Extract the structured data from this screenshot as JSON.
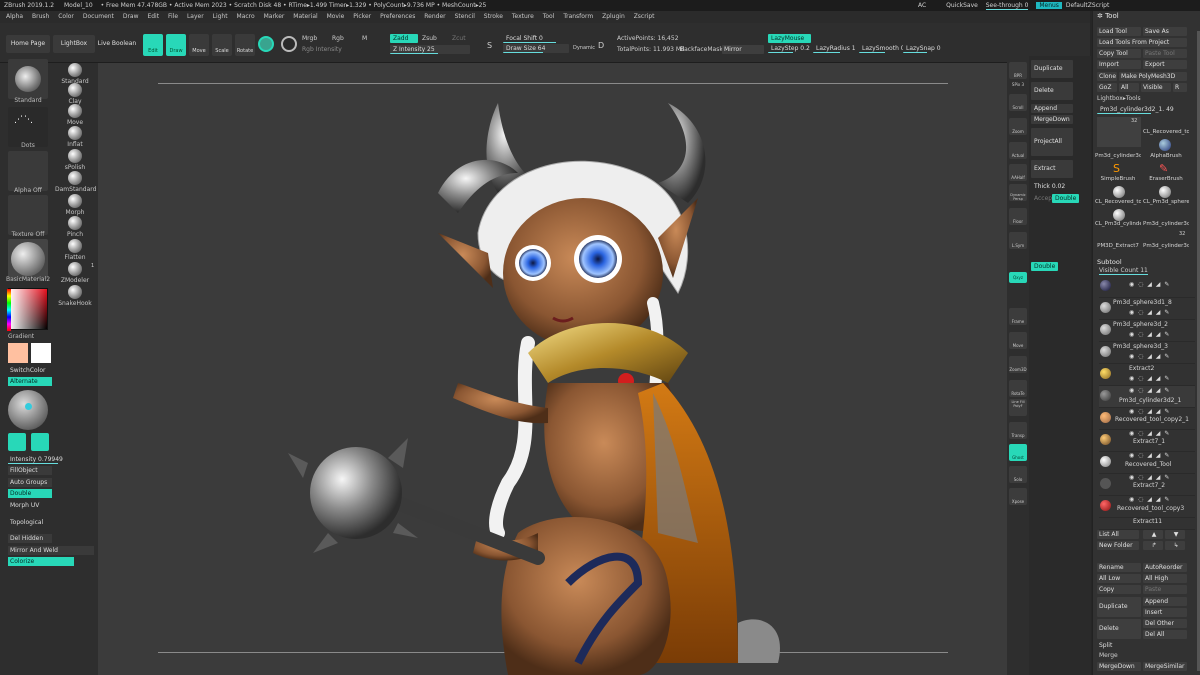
{
  "title_bar": {
    "app": "ZBrush 2019.1.2",
    "model": "Model_10",
    "stats": "• Free Mem 47.478GB • Active Mem 2023 • Scratch Disk 48 • RTime▸1.499 Timer▸1.329 • PolyCount▸9.736 MP • MeshCount▸25"
  },
  "right_menu": {
    "ac": "AC",
    "quicksave": "QuickSave",
    "seethrough": "See-through  0",
    "menus": "Menus",
    "defaultzscript": "DefaultZScript"
  },
  "menus": [
    "Alpha",
    "Brush",
    "Color",
    "Document",
    "Draw",
    "Edit",
    "File",
    "Layer",
    "Light",
    "Macro",
    "Marker",
    "Material",
    "Movie",
    "Picker",
    "Preferences",
    "Render",
    "Stencil",
    "Stroke",
    "Texture",
    "Tool",
    "Transform",
    "Zplugin",
    "Zscript"
  ],
  "shelf": {
    "home_page": "Home Page",
    "lightbox": "LightBox",
    "live_boolean": "Live Boolean",
    "edit": "Edit",
    "draw": "Draw",
    "move": "Move",
    "scale": "Scale",
    "rotate": "Rotate",
    "mrgb": "Mrgb",
    "rgb": "Rgb",
    "m": "M",
    "rgb_intensity": "Rgb Intensity",
    "zadd": "Zadd",
    "zsub": "Zsub",
    "zcut": "Zcut",
    "z_intensity": "Z Intensity 25",
    "focal_shift": "Focal Shift 0",
    "draw_size": "Draw Size 64",
    "dynamic": "Dynamic",
    "active_points": "ActivePoints: 16,452",
    "total_points": "TotalPoints: 11.993 Mil",
    "backface_mask": "BackfaceMask",
    "mirror": "Mirror",
    "lazymouse": "LazyMouse",
    "lazystep": "LazyStep 0.25",
    "lazyradius": "LazyRadius 1",
    "lazysmooth": "LazySmooth 0",
    "lazysnap": "LazySnap 0",
    "s_label": "S",
    "d_label": "D"
  },
  "left_panel": {
    "standard_top": "Standard",
    "standard": "Standard",
    "dots": "Dots",
    "alpha_off": "Alpha Off",
    "texture_off": "Texture Off",
    "material": "BasicMaterial2",
    "brushes": [
      "Standard",
      "Clay",
      "Move",
      "Inflat",
      "sPolish",
      "DamStandard",
      "Morph",
      "Pinch",
      "Flatten",
      "ZModeler",
      "SnakeHook"
    ],
    "brush_count": "1",
    "gradient": "Gradient",
    "switch_color": "SwitchColor",
    "alternate": "Alternate",
    "intensity": "Intensity 0.79949",
    "fill_object": "FillObject",
    "auto_groups": "Auto Groups",
    "double": "Double",
    "morph_uv": "Morph UV",
    "topological": "Topological",
    "del_hidden": "Del Hidden",
    "mirror_and_weld": "Mirror And Weld",
    "colorize": "Colorize"
  },
  "right_shelf": [
    "BPR",
    "SPix 3",
    "Scroll",
    "Zoom",
    "Actual",
    "AAHalf",
    "Dynamic Persp",
    "Floor",
    "L.Sym",
    "Qxyz",
    "Frame",
    "Move",
    "Zoom3D",
    "RotaTe",
    "Line Fill PolyF",
    "Transp",
    "Ghost",
    "Solo",
    "Xpose"
  ],
  "mid_right": {
    "duplicate": "Duplicate",
    "delete": "Delete",
    "append": "Append",
    "merge_down": "MergeDown",
    "project_all": "ProjectAll",
    "extract": "Extract",
    "thick": "Thick 0.02",
    "accept": "Accept",
    "double_top": "Double",
    "double_mid": "Double"
  },
  "tool_panel": {
    "header": "Tool",
    "load_tool": "Load Tool",
    "save_as": "Save As",
    "load_from_project": "Load Tools From Project",
    "copy_tool": "Copy Tool",
    "paste_tool": "Paste Tool",
    "import": "Import",
    "export": "Export",
    "clone": "Clone",
    "make_polymesh": "Make PolyMesh3D",
    "goz": "GoZ",
    "all": "All",
    "visible": "Visible",
    "r": "R",
    "lightbox_tools": "Lightbox▸Tools",
    "current_tool": "Pm3d_cylinder3d2_1. 49",
    "thumb_count_1": "32",
    "thumb_count_2": "32",
    "thumbs": [
      "Pm3d_cylinder3c",
      "CL_Recovered_to",
      "AlphaBrush",
      "SimpleBrush",
      "EraserBrush",
      "CL_Recovered_to",
      "CL_Pm3d_sphere",
      "CL_Pm3d_cylinder",
      "Pm3d_cylinder3c",
      "PM3D_Extract7",
      "Pm3d_cylinder3c"
    ],
    "subtool_header": "Subtool",
    "visible_count": "Visible Count 11",
    "subtools": [
      "Pm3d_sphere3d1_8",
      "Pm3d_sphere3d_2",
      "Pm3d_sphere3d_3",
      "Extract2",
      "Pm3d_cylinder3d2_1",
      "Recovered_tool_copy2_1",
      "Extract7_1",
      "Recovered_Tool",
      "Extract7_2",
      "Recovered_tool_copy3",
      "Extract11"
    ],
    "list_all": "List All",
    "new_folder": "New Folder",
    "rename": "Rename",
    "autoreorder": "AutoReorder",
    "all_low": "All Low",
    "all_high": "All High",
    "copy": "Copy",
    "paste": "Paste",
    "append": "Append",
    "duplicate": "Duplicate",
    "insert": "Insert",
    "delete": "Delete",
    "del_other": "Del Other",
    "del_all": "Del All",
    "split": "Split",
    "merge_header": "Merge",
    "merge_down": "MergeDown",
    "merge_similar": "MergeSimilar"
  },
  "colors": {
    "accent": "#28d8b8",
    "panel": "#2e2e2e",
    "canvas": "#3b3b3b",
    "primary_swatch": "#ffc0a0",
    "secondary_swatch": "#ffffff"
  }
}
